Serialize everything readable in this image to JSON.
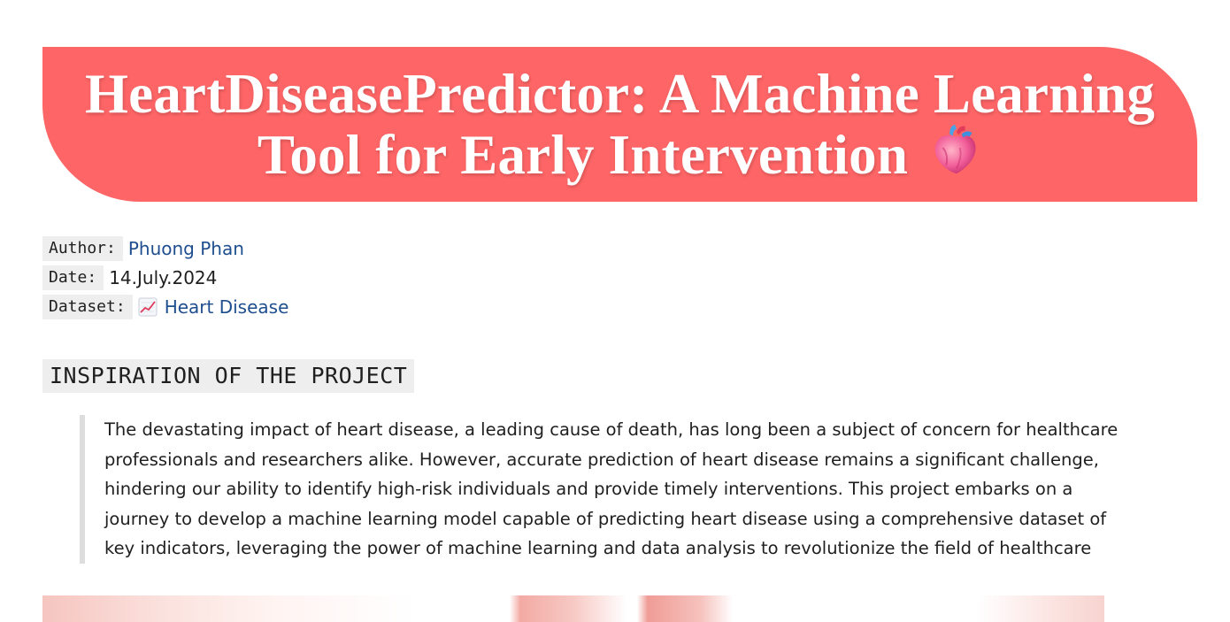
{
  "banner": {
    "title": "HeartDiseasePredictor: A Machine Learning Tool for Early Intervention",
    "icon": "anatomical-heart-icon",
    "background_color": "#fe6566"
  },
  "meta": {
    "author_label": "Author:",
    "author_value": "Phuong Phan",
    "date_label": "Date:",
    "date_value": "14.July.2024",
    "dataset_label": "Dataset:",
    "dataset_icon": "chart-increasing-icon",
    "dataset_value": "Heart Disease",
    "link_color": "#1f4e8f"
  },
  "section": {
    "heading": "INSPIRATION OF THE PROJECT",
    "quote": "The devastating impact of heart disease, a leading cause of death, has long been a subject of concern for healthcare professionals and researchers alike. However, accurate prediction of heart disease remains a significant challenge, hindering our ability to identify high-risk individuals and provide timely interventions. This project embarks on a journey to develop a machine learning model capable of predicting heart disease using a comprehensive dataset of key indicators, leveraging the power of machine learning and data analysis to revolutionize the field of healthcare"
  }
}
